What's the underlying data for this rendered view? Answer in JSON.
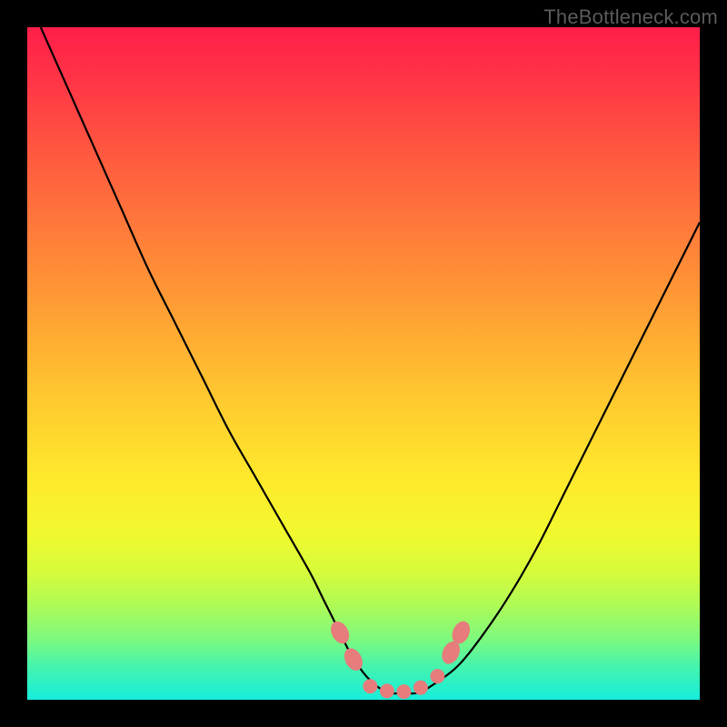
{
  "watermark": "TheBottleneck.com",
  "chart_data": {
    "type": "line",
    "title": "",
    "xlabel": "",
    "ylabel": "",
    "xlim": [
      0,
      100
    ],
    "ylim": [
      0,
      100
    ],
    "grid": false,
    "legend": false,
    "series": [
      {
        "name": "bottleneck-curve",
        "color": "#000000",
        "x": [
          2,
          6,
          10,
          14,
          18,
          22,
          26,
          30,
          34,
          38,
          42,
          44,
          46,
          48,
          50,
          52,
          54,
          56,
          58,
          60,
          64,
          68,
          72,
          76,
          80,
          84,
          88,
          92,
          96,
          100
        ],
        "y": [
          100,
          91,
          82,
          73,
          64,
          56,
          48,
          40,
          33,
          26,
          19,
          15,
          11,
          7,
          4,
          2,
          1,
          1,
          1,
          2,
          5,
          10,
          16,
          23,
          31,
          39,
          47,
          55,
          63,
          71
        ]
      }
    ],
    "markers": [
      {
        "name": "left-cluster",
        "shape": "blob",
        "color": "#e77c7c",
        "x": 46.5,
        "y": 10
      },
      {
        "name": "left-cluster-2",
        "shape": "blob",
        "color": "#e77c7c",
        "x": 48.5,
        "y": 6
      },
      {
        "name": "trough-1",
        "shape": "round",
        "color": "#e77c7c",
        "x": 51,
        "y": 2
      },
      {
        "name": "trough-2",
        "shape": "round",
        "color": "#e77c7c",
        "x": 53.5,
        "y": 1.3
      },
      {
        "name": "trough-3",
        "shape": "round",
        "color": "#e77c7c",
        "x": 56,
        "y": 1.2
      },
      {
        "name": "trough-4",
        "shape": "round",
        "color": "#e77c7c",
        "x": 58.5,
        "y": 1.8
      },
      {
        "name": "right-cluster",
        "shape": "round",
        "color": "#e77c7c",
        "x": 61,
        "y": 3.5
      },
      {
        "name": "right-cluster-2",
        "shape": "blob",
        "color": "#e77c7c",
        "x": 63,
        "y": 7
      },
      {
        "name": "right-cluster-3",
        "shape": "blob",
        "color": "#e77c7c",
        "x": 64.5,
        "y": 10
      }
    ]
  }
}
